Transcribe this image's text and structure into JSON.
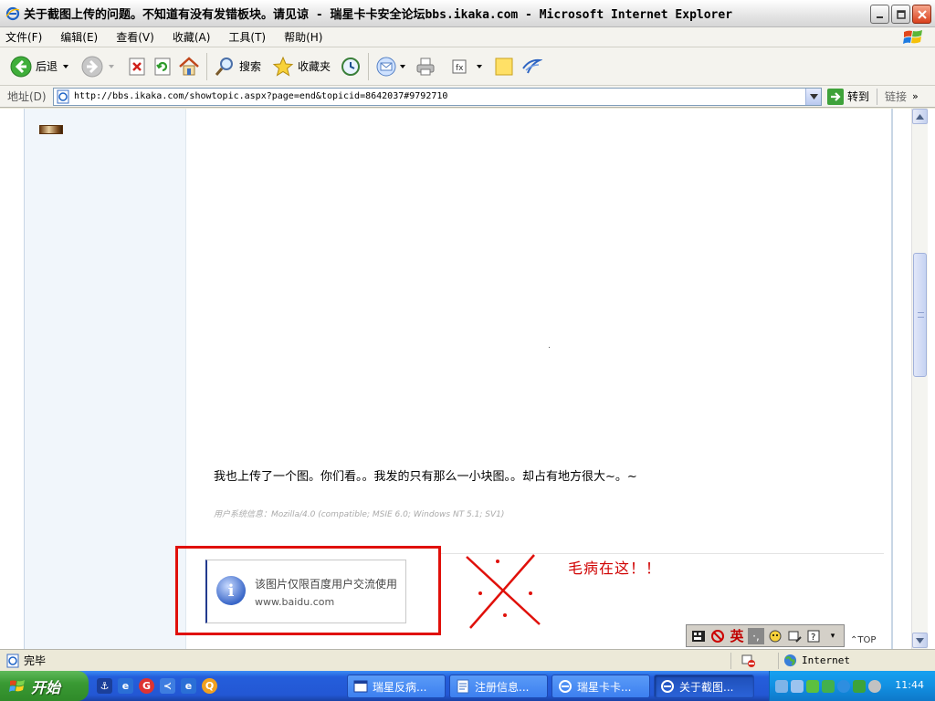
{
  "window": {
    "title": "关于截图上传的问题。不知道有没有发错板块。请见谅 - 瑞星卡卡安全论坛bbs.ikaka.com - Microsoft Internet Explorer",
    "minimize_icon": "minimize-icon",
    "maximize_icon": "maximize-icon",
    "close_icon": "close-icon"
  },
  "menubar": {
    "items": [
      "文件(F)",
      "编辑(E)",
      "查看(V)",
      "收藏(A)",
      "工具(T)",
      "帮助(H)"
    ]
  },
  "toolbar": {
    "back_label": "后退",
    "search_label": "搜索",
    "favorites_label": "收藏夹"
  },
  "addressbar": {
    "label": "地址(D)",
    "url": "http://bbs.ikaka.com/showtopic.aspx?page=end&topicid=8642037#9792710",
    "go_label": "转到",
    "links_label": "链接"
  },
  "post": {
    "text": "我也上传了一个图。你们看。。我发的只有那么一小块图。。却占有地方很大~。~",
    "system_info": "用户系统信息：Mozilla/4.0 (compatible; MSIE 6.0; Windows NT 5.1; SV1)",
    "baidu_notice_line1": "该图片仅限百度用户交流使用",
    "baidu_notice_line2": "www.baidu.com",
    "annotation": "毛病在这！！",
    "top_link": "TOP"
  },
  "ime": {
    "lang_label": "英"
  },
  "statusbar": {
    "status": "完毕",
    "zone": "Internet"
  },
  "taskbar": {
    "start_label": "开始",
    "tasks": [
      {
        "label": "瑞星反病..."
      },
      {
        "label": "注册信息..."
      },
      {
        "label": "瑞星卡卡..."
      },
      {
        "label": "关于截图..."
      }
    ],
    "clock": "11:44"
  },
  "colors": {
    "annotation_red": "#e0100a",
    "xp_blue": "#245edb",
    "start_green": "#3a9a34"
  }
}
